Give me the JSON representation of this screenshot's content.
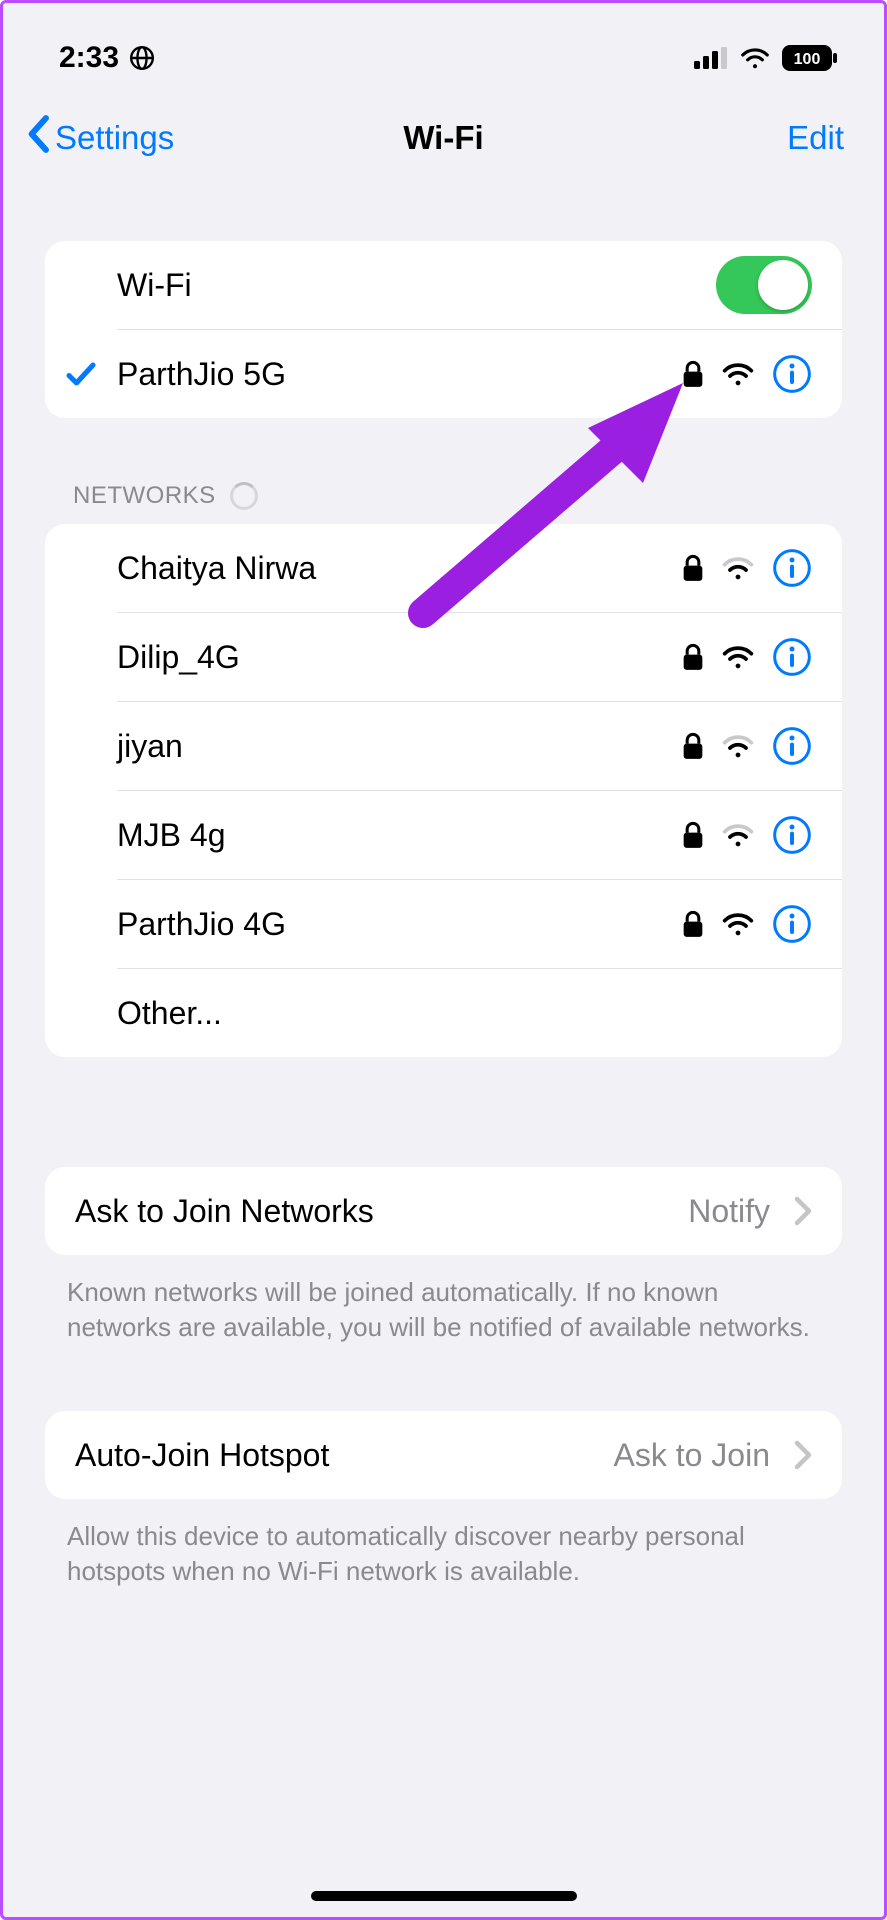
{
  "status": {
    "time": "2:33",
    "battery_text": "100"
  },
  "nav": {
    "back_label": "Settings",
    "title": "Wi-Fi",
    "edit_label": "Edit"
  },
  "wifi_toggle": {
    "label": "Wi-Fi",
    "on": true
  },
  "connected_network": {
    "name": "ParthJio 5G",
    "locked": true,
    "signal": 3
  },
  "section_networks_title": "NETWORKS",
  "networks": [
    {
      "name": "Chaitya Nirwa",
      "locked": true,
      "signal": 2
    },
    {
      "name": "Dilip_4G",
      "locked": true,
      "signal": 3
    },
    {
      "name": "jiyan",
      "locked": true,
      "signal": 2
    },
    {
      "name": "MJB 4g",
      "locked": true,
      "signal": 2
    },
    {
      "name": "ParthJio 4G",
      "locked": true,
      "signal": 3
    }
  ],
  "other_label": "Other...",
  "ask_to_join": {
    "label": "Ask to Join Networks",
    "value": "Notify",
    "footer": "Known networks will be joined automatically. If no known networks are available, you will be notified of available networks."
  },
  "auto_join": {
    "label": "Auto-Join Hotspot",
    "value": "Ask to Join",
    "footer": "Allow this device to automatically discover nearby personal hotspots when no Wi-Fi network is available."
  }
}
